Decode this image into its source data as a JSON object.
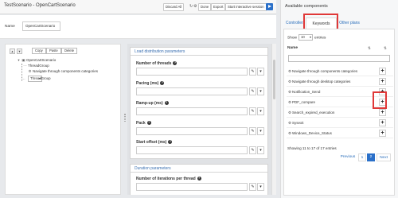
{
  "header": {
    "title": "TestScenario - OpenCartScenario",
    "buttons": [
      "Discard All",
      "Done",
      "Export",
      "Start interactive session"
    ]
  },
  "name_field": {
    "label": "Name",
    "value": "OpenCartScenario"
  },
  "tree": {
    "toolbar": [
      "Copy",
      "Paste",
      "Delete"
    ],
    "nodes": [
      {
        "label": "OpenCartScenario",
        "icon": "folder-icon"
      },
      {
        "label": "ThreadGroup",
        "icon": "thread-icon"
      },
      {
        "label": "Navigate through components categories",
        "icon": "gear-icon"
      },
      {
        "label": "ThreadGroup",
        "icon": "thread-icon",
        "selected": true
      }
    ]
  },
  "sections": {
    "load_title": "Load distribution parameters",
    "fields": [
      "Number of threads",
      "Pacing (ms)",
      "Ramp-up (ms)",
      "Pack",
      "Start offset (ms)"
    ],
    "duration_title": "Duration parameters",
    "duration_field": "Number of iterations per thread"
  },
  "available": {
    "title": "Available components",
    "tabs": [
      "Controllers",
      "Keywords",
      "Other plans"
    ],
    "active_tab": "Keywords",
    "show_label": "Show",
    "show_value": "10",
    "entries_label": "entries",
    "column": "Name",
    "items": [
      "Navigate through components categories",
      "Navigate through desktop categories",
      "Notification_Send",
      "PDF_compare",
      "Search_expired_execution",
      "Sysexit",
      "Windows_Device_Status"
    ],
    "info": "Showing 11 to 17 of 17 entries",
    "pager": [
      "Previous",
      "1",
      "2",
      "Next"
    ],
    "current_page": "2"
  },
  "colors": {
    "accent": "#2b70c9",
    "highlight": "#e03838",
    "selected_row": "#2d6cc0"
  }
}
